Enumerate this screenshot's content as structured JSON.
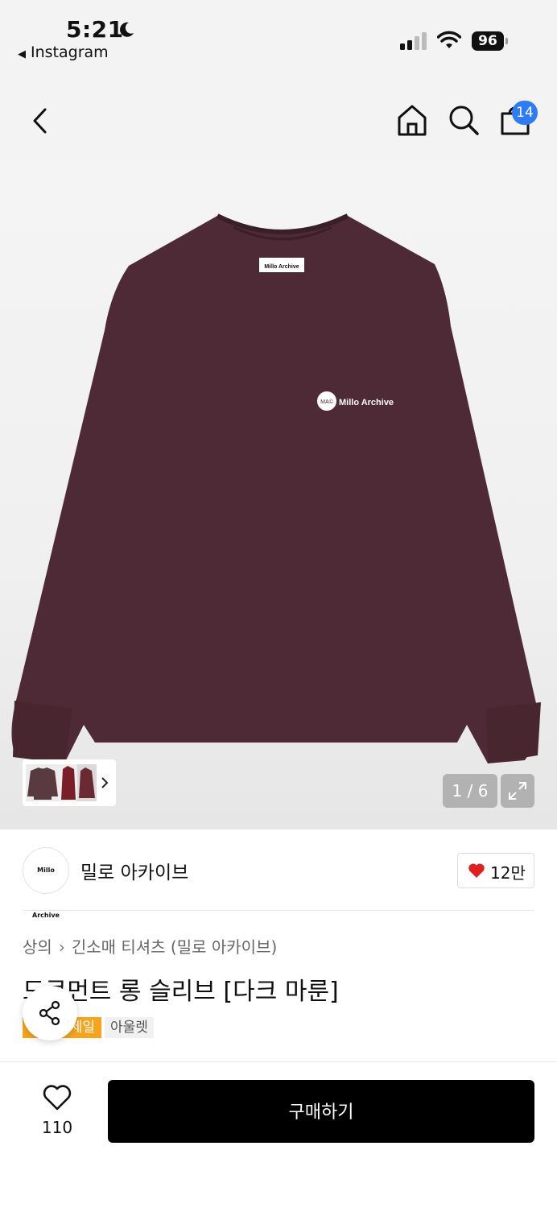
{
  "status_bar": {
    "time": "5:21",
    "back_app": "Instagram",
    "battery": "96"
  },
  "nav": {
    "cart_count": "14"
  },
  "gallery": {
    "page_indicator": "1 / 6",
    "tag_label": "Millo Archive",
    "logo_mark": "MA©",
    "logo_text": "Millo Archive"
  },
  "brand": {
    "logo_text": "Millo Archive",
    "name": "밀로 아카이브",
    "like_count": "12만"
  },
  "product": {
    "breadcrumb": [
      "상의",
      "긴소매 티셔츠 (밀로 아카이브)"
    ],
    "title": "도큐먼트 롱 슬리브 [다크 마룬]",
    "tags": [
      "세일",
      "아울렛"
    ]
  },
  "bottom_bar": {
    "wish_count": "110",
    "buy_label": "구매하기"
  },
  "colors": {
    "shirt": "#4d2a35",
    "badge": "#2f7bf6",
    "sale_tag": "#f6a41c",
    "heart": "#e02020"
  }
}
